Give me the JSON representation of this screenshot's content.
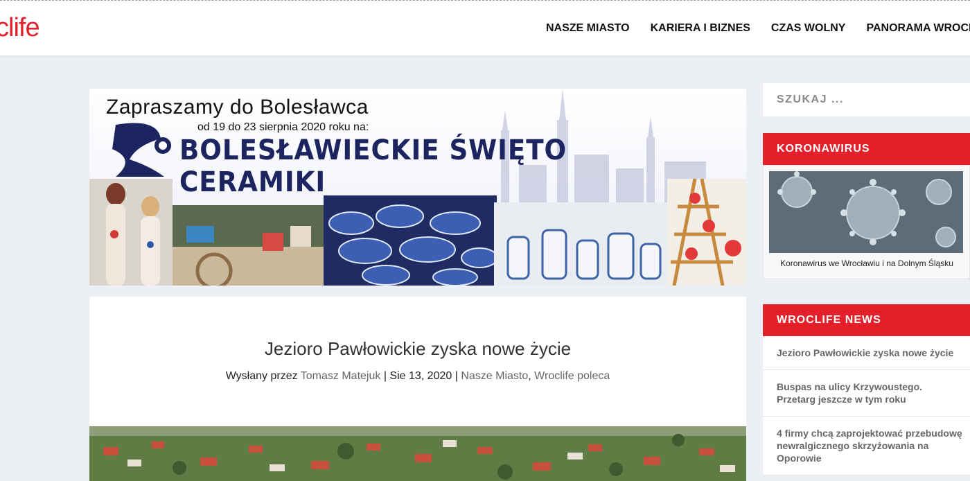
{
  "header": {
    "logo_text": "clife",
    "nav": [
      "NASZE MIASTO",
      "KARIERA I BIZNES",
      "CZAS WOLNY",
      "PANORAMA WROCL"
    ]
  },
  "banner": {
    "line1": "Zapraszamy do Bolesławca",
    "line2": "od 19 do 23 sierpnia 2020 roku na:",
    "line3": "BOLESŁAWIECKIE ŚWIĘTO CERAMIKI"
  },
  "article": {
    "title": "Jezioro Pawłowickie zyska nowe życie",
    "meta_prefix": "Wysłany przez",
    "author": "Tomasz Matejuk",
    "sep1": "|",
    "date": "Sie 13, 2020",
    "sep2": "|",
    "category1": "Nasze Miasto",
    "comma": ",",
    "category2": "Wroclife poleca"
  },
  "sidebar": {
    "search_placeholder": "SZUKAJ ...",
    "corona_heading": "KORONAWIRUS",
    "corona_caption": "Koronawirus we Wrocławiu i na Dolnym Śląsku",
    "news_heading": "WROCLIFE NEWS",
    "news": [
      "Jezioro Pawłowickie zyska nowe życie",
      "Buspas na ulicy Krzywoustego. Przetarg jeszcze w tym roku",
      "4 firmy chcą zaprojektować przebudowę newralgicznego skrzyżowania na Oporowie"
    ]
  },
  "colors": {
    "accent": "#e3202a",
    "brand_red": "#e0202d",
    "banner_navy": "#1c2560"
  }
}
